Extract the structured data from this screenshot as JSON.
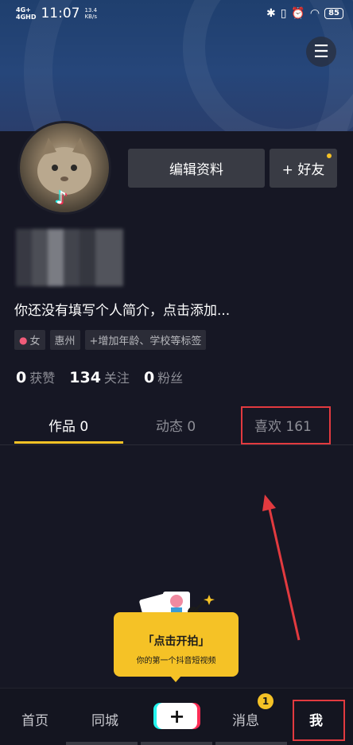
{
  "status_bar": {
    "network_1": "4G+",
    "network_2": "4GHD",
    "time": "11:07",
    "speed_value": "13.4",
    "speed_unit": "KB/s",
    "battery": "85"
  },
  "profile": {
    "edit_label": "编辑资料",
    "add_friend_label": "+ 好友",
    "bio": "你还没有填写个人简介，点击添加...",
    "tags": [
      "女",
      "惠州",
      "+增加年龄、学校等标签"
    ]
  },
  "stats": {
    "likes_count": "0",
    "likes_label": "获赞",
    "following_count": "134",
    "following_label": "关注",
    "followers_count": "0",
    "followers_label": "粉丝"
  },
  "tabs": {
    "works": "作品 0",
    "dynamic": "动态 0",
    "likes": "喜欢 161"
  },
  "record_popup": {
    "title": "「点击开拍」",
    "subtitle": "你的第一个抖音短视频"
  },
  "bottom_nav": {
    "home": "首页",
    "nearby": "同城",
    "plus": "+",
    "messages": "消息",
    "messages_badge": "1",
    "me": "我"
  },
  "colors": {
    "accent_yellow": "#f5c226",
    "annotation_red": "#e23a3f",
    "background": "#161724"
  }
}
